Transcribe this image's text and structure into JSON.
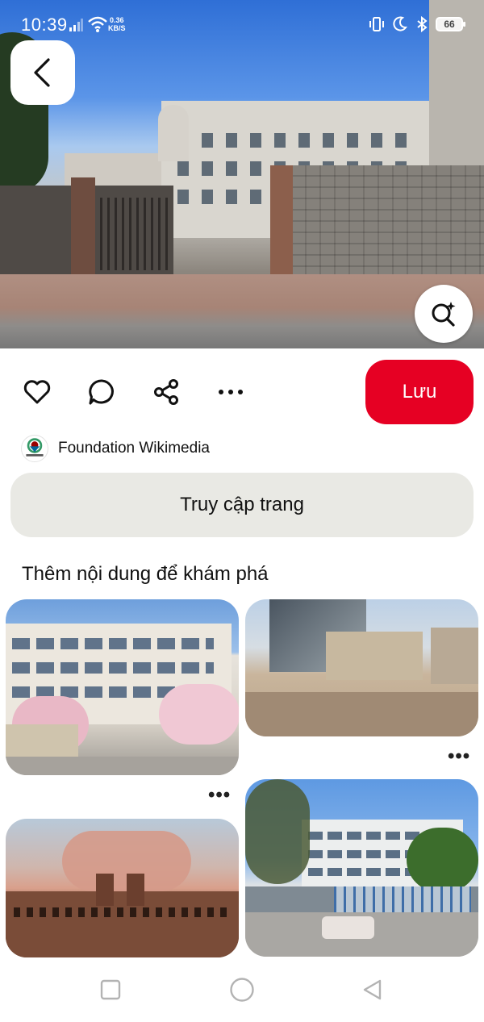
{
  "status_bar": {
    "time": "10:39",
    "speed_value": "0.36",
    "speed_unit": "KB/S",
    "battery": "66"
  },
  "pin": {
    "save_label": "Lưu",
    "source_name": "Foundation Wikimedia",
    "visit_label": "Truy cập trang"
  },
  "feed": {
    "title": "Thêm nội dung để khám phá",
    "more_label": "•••"
  },
  "colors": {
    "save_red": "#e60023",
    "visit_gray": "#e9e9e4"
  },
  "icons": {
    "back": "chevron-left-icon",
    "lens": "visual-search-icon",
    "heart": "heart-icon",
    "comment": "comment-icon",
    "share": "share-icon",
    "more": "more-horizontal-icon",
    "nav_recent": "square-icon",
    "nav_home": "circle-icon",
    "nav_back": "triangle-back-icon"
  }
}
